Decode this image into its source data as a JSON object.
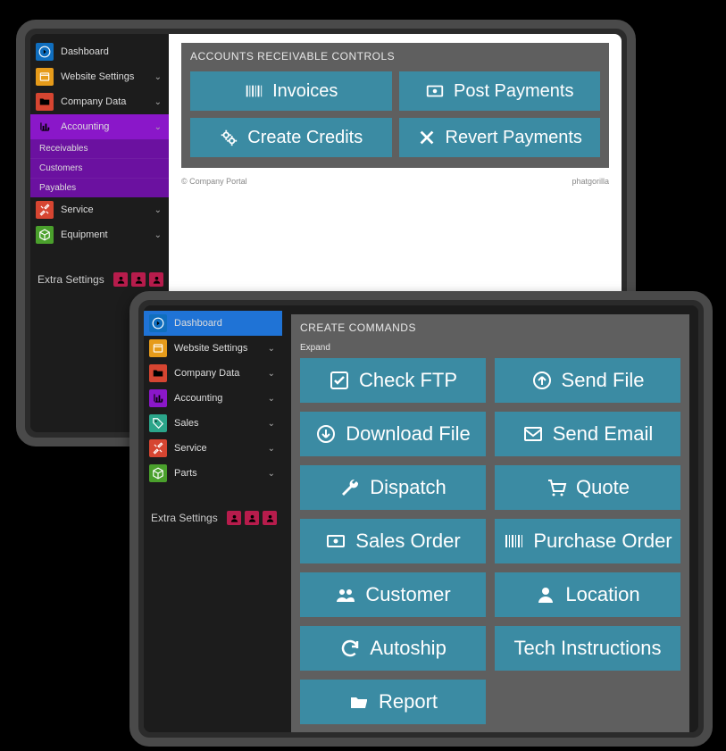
{
  "colors": {
    "accent": "#3b8ba3",
    "active": "#1f73d6",
    "expanded": "#8a17c9"
  },
  "tablet1": {
    "sidebar": {
      "items": [
        {
          "label": "Dashboard",
          "tile": "c-blue",
          "icon": "arrow-right-circle",
          "chev": false
        },
        {
          "label": "Website Settings",
          "tile": "c-orange",
          "icon": "window",
          "chev": true
        },
        {
          "label": "Company Data",
          "tile": "c-red",
          "icon": "folder",
          "chev": true
        },
        {
          "label": "Accounting",
          "tile": "c-purple",
          "icon": "chart",
          "chev": true,
          "expanded": true,
          "subs": [
            "Receivables",
            "Customers",
            "Payables"
          ]
        },
        {
          "label": "Service",
          "tile": "c-red",
          "icon": "tools",
          "chev": true
        },
        {
          "label": "Equipment",
          "tile": "c-green",
          "icon": "cube",
          "chev": true
        }
      ],
      "extra_label": "Extra Settings",
      "mini": [
        "user-up",
        "user-down",
        "person"
      ]
    },
    "panel_title": "ACCOUNTS RECEIVABLE CONTROLS",
    "buttons": [
      {
        "label": "Invoices",
        "icon": "barcode"
      },
      {
        "label": "Post Payments",
        "icon": "payment"
      },
      {
        "label": "Create Credits",
        "icon": "gears"
      },
      {
        "label": "Revert Payments",
        "icon": "x"
      }
    ],
    "footer_left": "© Company Portal",
    "footer_right": "phatgorilla"
  },
  "tablet2": {
    "sidebar": {
      "items": [
        {
          "label": "Dashboard",
          "tile": "c-blue",
          "icon": "arrow-right-circle",
          "chev": false,
          "active": true
        },
        {
          "label": "Website Settings",
          "tile": "c-orange",
          "icon": "window",
          "chev": true
        },
        {
          "label": "Company Data",
          "tile": "c-red",
          "icon": "folder",
          "chev": true
        },
        {
          "label": "Accounting",
          "tile": "c-purple",
          "icon": "chart",
          "chev": true
        },
        {
          "label": "Sales",
          "tile": "c-teal2",
          "icon": "tag",
          "chev": true
        },
        {
          "label": "Service",
          "tile": "c-red",
          "icon": "tools",
          "chev": true
        },
        {
          "label": "Parts",
          "tile": "c-green",
          "icon": "cube",
          "chev": true
        }
      ],
      "extra_label": "Extra Settings",
      "mini": [
        "user-up",
        "user-down",
        "person"
      ]
    },
    "panel_title": "CREATE COMMANDS",
    "expand_label": "Expand",
    "buttons": [
      {
        "label": "Check FTP",
        "icon": "check-box"
      },
      {
        "label": "Send File",
        "icon": "upload"
      },
      {
        "label": "Download File",
        "icon": "download"
      },
      {
        "label": "Send Email",
        "icon": "mail"
      },
      {
        "label": "Dispatch",
        "icon": "wrench"
      },
      {
        "label": "Quote",
        "icon": "cart"
      },
      {
        "label": "Sales Order",
        "icon": "payment"
      },
      {
        "label": "Purchase Order",
        "icon": "barcode"
      },
      {
        "label": "Customer",
        "icon": "users"
      },
      {
        "label": "Location",
        "icon": "user"
      },
      {
        "label": "Autoship",
        "icon": "refresh"
      },
      {
        "label": "Tech Instructions",
        "icon": ""
      },
      {
        "label": "Report",
        "icon": "folder-open"
      }
    ]
  }
}
